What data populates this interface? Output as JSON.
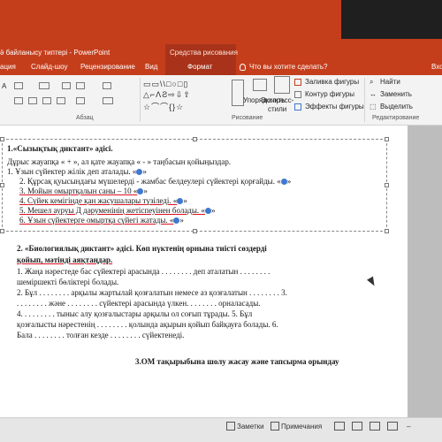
{
  "window": {
    "title": "ӛ байланысу типтері - PowerPoint",
    "context_group": "Средства рисования"
  },
  "tabs": [
    "ация",
    "Слайд-шоу",
    "Рецензирование",
    "Вид",
    "Формат",
    "Что вы хотите сделать?",
    "Вхо"
  ],
  "ribbon": {
    "paragraph_label": "Абзац",
    "drawing_label": "Рисование",
    "editing_label": "Редактирование",
    "arrange_label": "Упорядочить",
    "quick_styles_label_1": "Экспресс-",
    "quick_styles_label_2": "стили",
    "shape_fill": "Заливка фигуры",
    "shape_outline": "Контур фигуры",
    "shape_effects": "Эффекты фигуры",
    "find": "Найти",
    "replace": "Заменить",
    "select": "Выделить"
  },
  "slide": {
    "heading1": "1.«Сызықтық диктант» әдісі.",
    "intro": "Дұрыс жауапқа « + », ал қате жауапқа « - » таңбасын қойыңыздар.",
    "items": [
      "1.   Ұзын сүйектер жілік деп аталады. «",
      "2. Құрсақ қуысындағы мүшелерді - жамбас белдеулері сүйектері қорғайды. «",
      "3. Мойын омыртқалын саны – 10 «",
      "4. Сүйек кемігінде қан жасушалары түзіледі. «",
      "5. Мешел ауруы Д дәруменінің жетіспеуінен болады. «",
      "6. Ұзын сүйектерге омыртқа сүйегі жатады. «"
    ],
    "item_close": "»",
    "heading2_line1": "2.  «Биологиялық диктант» әдісі. Көп нүктенің орнына тиісті сөздерді",
    "heading2_line2": "қойып, мәтінді аяқтаңдар.",
    "body_lines": [
      "1. Жаңа нәрестеде бас сүйектері арасында . . . . . . . . деп аталатын . . . . . . . .",
      "шеміршекті бөліктері болады.",
      "2. Бұл . . . . . . . . арқылы жартылай қозғалатын немесе аз қозғалатын . . . . . . . . 3.",
      ". . . . . . . . және . . . . . . . . сүйектері арасында үлкен. . . . . . . . орналасады.",
      "4. . . . . . . . . тыныс алу қозғалыстары арқылы ол соғып тұрады. 5. Бұл",
      "қозғалысты нәрестенің . . . . . . . . қолында ақырын қойып байқауға болады. 6.",
      "Бала . . . . . . . . толған кезде . . . . . . . . сүйектенеді."
    ],
    "heading3": "3.ОМ тақырыбына шолу жасау және тапсырма орындау"
  },
  "status": {
    "notes": "Заметки",
    "comments": "Примечания"
  },
  "colors": {
    "accent": "#c43e1c",
    "context": "#a8331a",
    "dark": "#1f1f1f",
    "bullet": "#3f78d0"
  }
}
